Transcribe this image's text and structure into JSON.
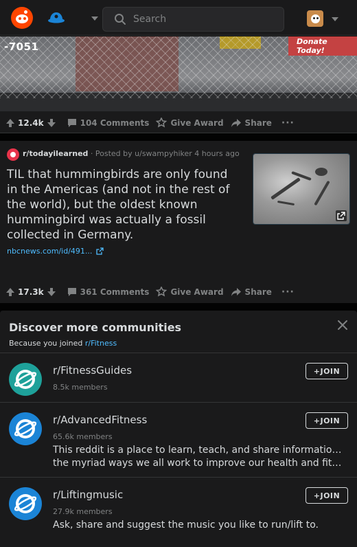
{
  "header": {
    "search_placeholder": "Search"
  },
  "post1": {
    "image_overlay_text": "-7051",
    "banner_text": "Donate Today!",
    "votes": "12.4k",
    "comments": "104 Comments",
    "award": "Give Award",
    "share": "Share",
    "more": "···"
  },
  "post2": {
    "subreddit": "r/todayilearned",
    "posted_by": "· Posted by u/swampyhiker 4 hours ago",
    "title": "TIL that hummingbirds are only found in the Americas (and not in the rest of the world), but the oldest known hummingbird was actually a fossil collected in Germany.",
    "link_text": "nbcnews.com/id/491...",
    "votes": "17.3k",
    "comments": "361 Comments",
    "award": "Give Award",
    "share": "Share",
    "more": "···"
  },
  "discover": {
    "title": "Discover more communities",
    "subtitle_prefix": "Because you joined ",
    "subtitle_sub": "r/Fitness",
    "communities": [
      {
        "name": "r/FitnessGuides",
        "members": "8.5k members",
        "description": "",
        "join": "+JOIN",
        "icon_color": "#1ea19a"
      },
      {
        "name": "r/AdvancedFitness",
        "members": "65.6k members",
        "description_line1": "This reddit is a place to learn, teach, and share information on",
        "description_line2": "the myriad ways we all work to improve our health and fitness,...",
        "join": "+JOIN",
        "icon_color": "#1b84d6"
      },
      {
        "name": "r/Liftingmusic",
        "members": "27.9k members",
        "description_line1": "Ask, share and suggest the music you like to run/lift to.",
        "join": "+JOIN",
        "icon_color": "#1b84d6"
      }
    ]
  },
  "colors": {
    "brand": "#ff4500",
    "link": "#4fbcff",
    "panel": "#1a1a1b",
    "text": "#d7dadc",
    "muted": "#818384"
  }
}
